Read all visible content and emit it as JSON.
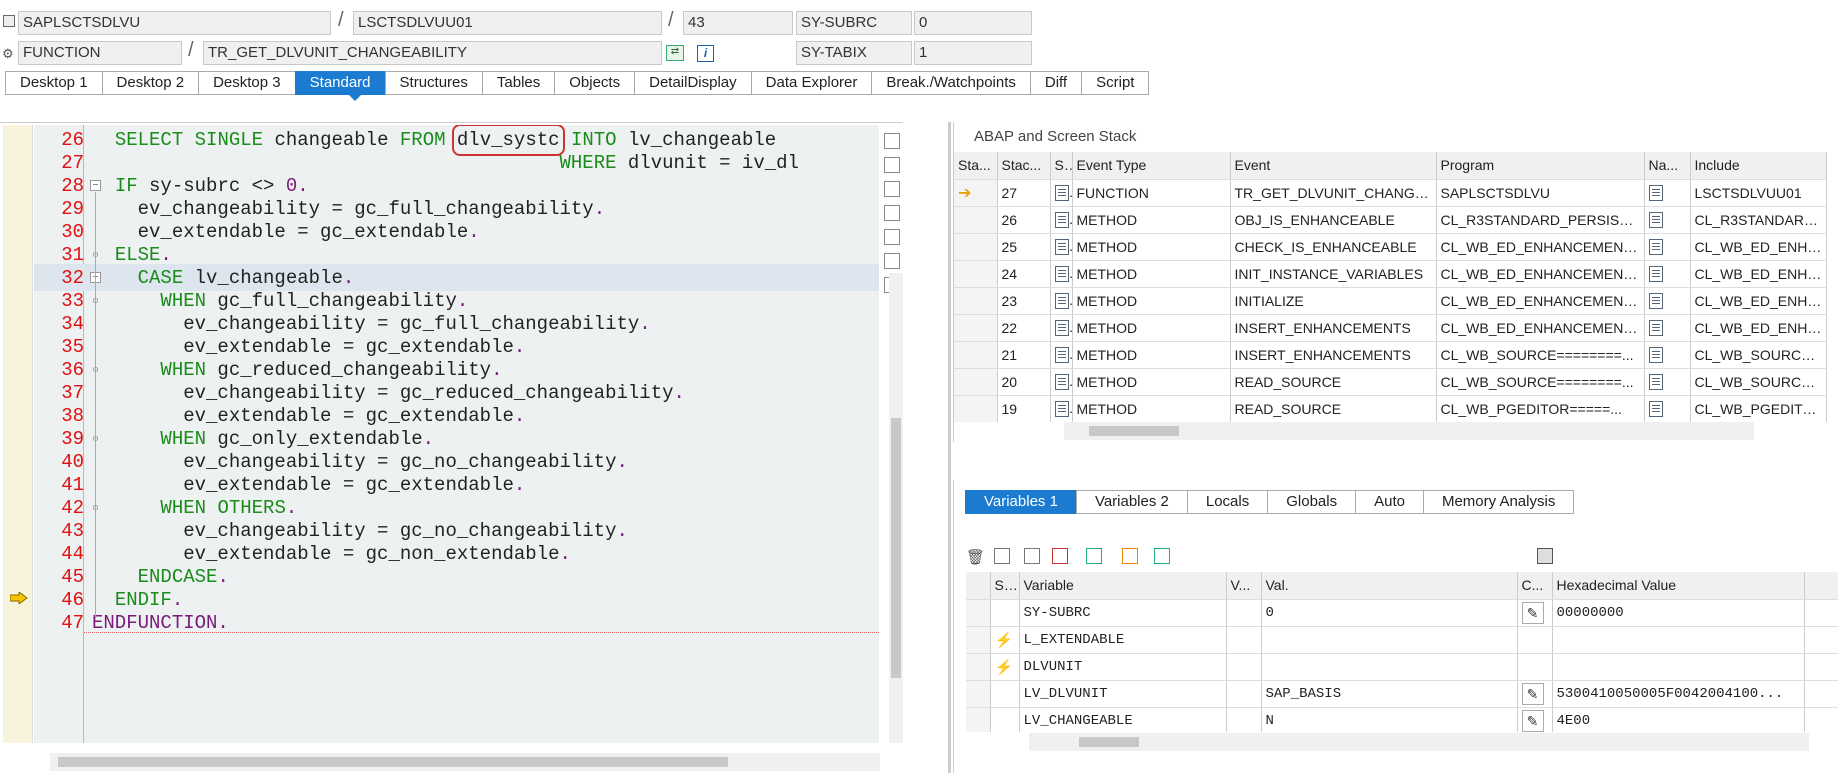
{
  "header": {
    "program": "SAPLSCTSDLVU",
    "include": "LSCTSDLVUU01",
    "line": "43",
    "event_type": "FUNCTION",
    "event": "TR_GET_DLVUNIT_CHANGEABILITY",
    "sysubrc_label": "SY-SUBRC",
    "sysubrc_value": "0",
    "sytabix_label": "SY-TABIX",
    "sytabix_value": "1",
    "slash": "/"
  },
  "tabs": [
    "Desktop 1",
    "Desktop 2",
    "Desktop 3",
    "Standard",
    "Structures",
    "Tables",
    "Objects",
    "DetailDisplay",
    "Data Explorer",
    "Break./Watchpoints",
    "Diff",
    "Script"
  ],
  "code": [
    {
      "n": "26",
      "t": "    SELECT SINGLE changeable FROM dlv_systc INTO lv_changeable"
    },
    {
      "n": "27",
      "t": "                                           WHERE dlvunit = iv_dl"
    },
    {
      "n": "28",
      "t": "    IF sy-subrc <> 0."
    },
    {
      "n": "29",
      "t": "      ev_changeability = gc_full_changeability."
    },
    {
      "n": "30",
      "t": "      ev_extendable = gc_extendable."
    },
    {
      "n": "31",
      "t": "    ELSE."
    },
    {
      "n": "32",
      "t": "      CASE lv_changeable."
    },
    {
      "n": "33",
      "t": "        WHEN gc_full_changeability."
    },
    {
      "n": "34",
      "t": "          ev_changeability = gc_full_changeability."
    },
    {
      "n": "35",
      "t": "          ev_extendable = gc_extendable."
    },
    {
      "n": "36",
      "t": "        WHEN gc_reduced_changeability."
    },
    {
      "n": "37",
      "t": "          ev_changeability = gc_reduced_changeability."
    },
    {
      "n": "38",
      "t": "          ev_extendable = gc_extendable."
    },
    {
      "n": "39",
      "t": "        WHEN gc_only_extendable."
    },
    {
      "n": "40",
      "t": "          ev_changeability = gc_no_changeability."
    },
    {
      "n": "41",
      "t": "          ev_extendable = gc_extendable."
    },
    {
      "n": "42",
      "t": "        WHEN OTHERS."
    },
    {
      "n": "43",
      "t": "          ev_changeability = gc_no_changeability."
    },
    {
      "n": "44",
      "t": "          ev_extendable = gc_non_extendable."
    },
    {
      "n": "45",
      "t": "      ENDCASE."
    },
    {
      "n": "46",
      "t": "    ENDIF."
    },
    {
      "n": "47",
      "t": "  ENDFUNCTION."
    }
  ],
  "current_line": "43",
  "highlight_token": "dlv_systc",
  "stack": {
    "title": "ABAP and Screen Stack",
    "columns": [
      "Sta...",
      "Stac...",
      "S...",
      "Event Type",
      "Event",
      "Program",
      "Na...",
      "Include"
    ],
    "rows": [
      {
        "cur": true,
        "level": "27",
        "type": "FUNCTION",
        "event": "TR_GET_DLVUNIT_CHANGEA...",
        "program": "SAPLSCTSDLVU",
        "include": "LSCTSDLVUU01"
      },
      {
        "cur": false,
        "level": "26",
        "type": "METHOD",
        "event": "OBJ_IS_ENHANCEABLE",
        "program": "CL_R3STANDARD_PERSISTEN...",
        "include": "CL_R3STANDARD_..."
      },
      {
        "cur": false,
        "level": "25",
        "type": "METHOD",
        "event": "CHECK_IS_ENHANCEABLE",
        "program": "CL_WB_ED_ENHANCEMENT_...",
        "include": "CL_WB_ED_ENHAN"
      },
      {
        "cur": false,
        "level": "24",
        "type": "METHOD",
        "event": "INIT_INSTANCE_VARIABLES",
        "program": "CL_WB_ED_ENHANCEMENT_...",
        "include": "CL_WB_ED_ENHAN"
      },
      {
        "cur": false,
        "level": "23",
        "type": "METHOD",
        "event": "INITIALIZE",
        "program": "CL_WB_ED_ENHANCEMENT_...",
        "include": "CL_WB_ED_ENHAN"
      },
      {
        "cur": false,
        "level": "22",
        "type": "METHOD",
        "event": "INSERT_ENHANCEMENTS",
        "program": "CL_WB_ED_ENHANCEMENT_...",
        "include": "CL_WB_ED_ENHAN"
      },
      {
        "cur": false,
        "level": "21",
        "type": "METHOD",
        "event": "INSERT_ENHANCEMENTS",
        "program": "CL_WB_SOURCE========...",
        "include": "CL_WB_SOURCE==="
      },
      {
        "cur": false,
        "level": "20",
        "type": "METHOD",
        "event": "READ_SOURCE",
        "program": "CL_WB_SOURCE========...",
        "include": "CL_WB_SOURCE==="
      },
      {
        "cur": false,
        "level": "19",
        "type": "METHOD",
        "event": "READ_SOURCE",
        "program": "CL_WB_PGEDITOR=====...",
        "include": "CL_WB_PGEDITOR"
      }
    ]
  },
  "vars": {
    "tabs": [
      "Variables 1",
      "Variables 2",
      "Locals",
      "Globals",
      "Auto",
      "Memory Analysis"
    ],
    "columns": [
      "St...",
      "Variable",
      "V...",
      "Val.",
      "C...",
      "Hexadecimal Value"
    ],
    "rows": [
      {
        "changed": false,
        "name": "SY-SUBRC",
        "val": "0",
        "edit": true,
        "hex": "00000000"
      },
      {
        "changed": true,
        "name": "L_EXTENDABLE",
        "val": "",
        "edit": false,
        "hex": ""
      },
      {
        "changed": true,
        "name": "DLVUNIT",
        "val": "",
        "edit": false,
        "hex": ""
      },
      {
        "changed": false,
        "name": "LV_DLVUNIT",
        "val": "SAP_BASIS",
        "edit": true,
        "hex": "5300410050005F0042004100..."
      },
      {
        "changed": false,
        "name": "LV_CHANGEABLE",
        "val": "N",
        "edit": true,
        "hex": "4E00"
      }
    ]
  }
}
